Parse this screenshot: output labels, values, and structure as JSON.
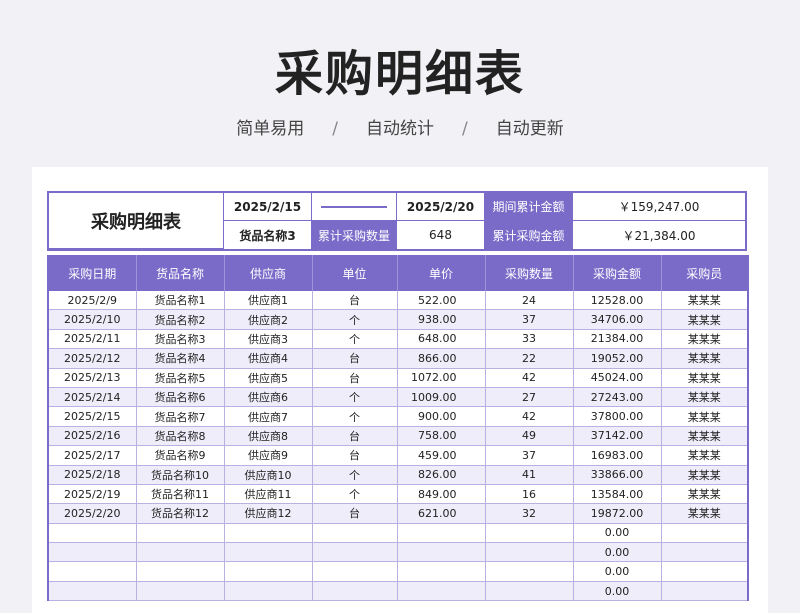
{
  "page": {
    "title": "采购明细表",
    "subtitle": [
      "简单易用",
      "自动统计",
      "自动更新"
    ],
    "subtitle_sep": "/"
  },
  "summary": {
    "title": "采购明细表",
    "date_start": "2025/2/15",
    "date_end": "2025/2/20",
    "period_total_label": "期间累计金额",
    "period_total_value": "￥159,247.00",
    "product_name": "货品名称3",
    "cum_qty_label": "累计采购数量",
    "cum_qty_value": "648",
    "cum_amt_label": "累计采购金额",
    "cum_amt_value": "￥21,384.00"
  },
  "table": {
    "headers": [
      "采购日期",
      "货品名称",
      "供应商",
      "单位",
      "单价",
      "采购数量",
      "采购金额",
      "采购员"
    ],
    "rows": [
      [
        "2025/2/9",
        "货品名称1",
        "供应商1",
        "台",
        "522.00",
        "24",
        "12528.00",
        "某某某"
      ],
      [
        "2025/2/10",
        "货品名称2",
        "供应商2",
        "个",
        "938.00",
        "37",
        "34706.00",
        "某某某"
      ],
      [
        "2025/2/11",
        "货品名称3",
        "供应商3",
        "个",
        "648.00",
        "33",
        "21384.00",
        "某某某"
      ],
      [
        "2025/2/12",
        "货品名称4",
        "供应商4",
        "台",
        "866.00",
        "22",
        "19052.00",
        "某某某"
      ],
      [
        "2025/2/13",
        "货品名称5",
        "供应商5",
        "台",
        "1072.00",
        "42",
        "45024.00",
        "某某某"
      ],
      [
        "2025/2/14",
        "货品名称6",
        "供应商6",
        "个",
        "1009.00",
        "27",
        "27243.00",
        "某某某"
      ],
      [
        "2025/2/15",
        "货品名称7",
        "供应商7",
        "个",
        "900.00",
        "42",
        "37800.00",
        "某某某"
      ],
      [
        "2025/2/16",
        "货品名称8",
        "供应商8",
        "台",
        "758.00",
        "49",
        "37142.00",
        "某某某"
      ],
      [
        "2025/2/17",
        "货品名称9",
        "供应商9",
        "台",
        "459.00",
        "37",
        "16983.00",
        "某某某"
      ],
      [
        "2025/2/18",
        "货品名称10",
        "供应商10",
        "个",
        "826.00",
        "41",
        "33866.00",
        "某某某"
      ],
      [
        "2025/2/19",
        "货品名称11",
        "供应商11",
        "个",
        "849.00",
        "16",
        "13584.00",
        "某某某"
      ],
      [
        "2025/2/20",
        "货品名称12",
        "供应商12",
        "台",
        "621.00",
        "32",
        "19872.00",
        "某某某"
      ],
      [
        "",
        "",
        "",
        "",
        "",
        "",
        "0.00",
        ""
      ],
      [
        "",
        "",
        "",
        "",
        "",
        "",
        "0.00",
        ""
      ],
      [
        "",
        "",
        "",
        "",
        "",
        "",
        "0.00",
        ""
      ],
      [
        "",
        "",
        "",
        "",
        "",
        "",
        "0.00",
        ""
      ]
    ]
  }
}
